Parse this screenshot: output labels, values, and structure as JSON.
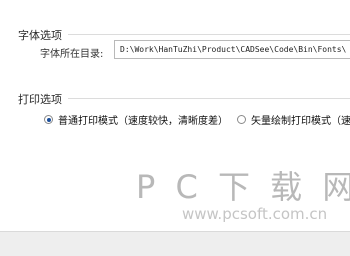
{
  "font_section": {
    "title": "字体选项",
    "dir_label": "字体所在目录:",
    "dir_value": "D:\\Work\\HanTuZhi\\Product\\CADSee\\Code\\Bin\\Fonts\\"
  },
  "print_section": {
    "title": "打印选项",
    "options": [
      {
        "label": "普通打印模式（速度较快，清晰度差）",
        "selected": true
      },
      {
        "label": "矢量绘制打印模式（速度",
        "selected": false
      }
    ]
  },
  "watermark": {
    "title": "P C 下 载 网",
    "url": "www.pcsoft.com.cn"
  }
}
